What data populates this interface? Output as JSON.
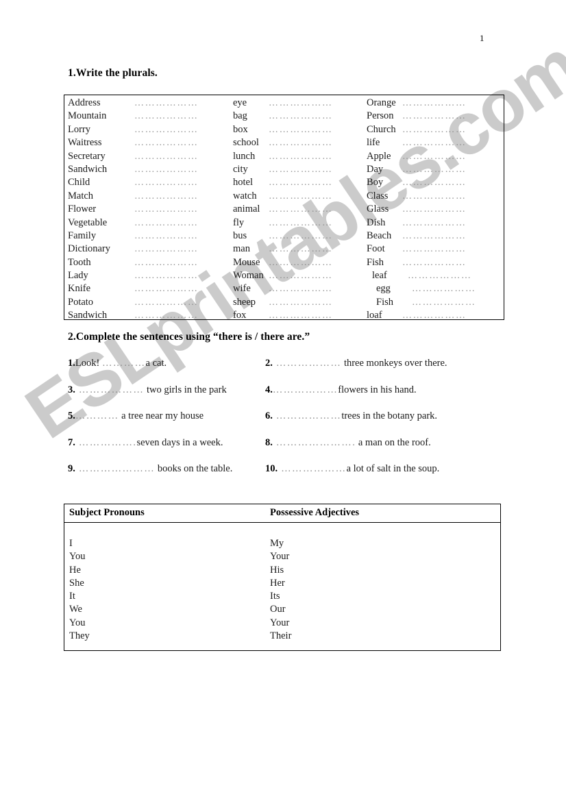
{
  "page": {
    "number": "1",
    "watermark": "ESLprintables.com",
    "watermark_color": "#c9c9c9"
  },
  "sections": {
    "plurals": {
      "heading": "1.Write the plurals.",
      "dots": "………………",
      "columns": [
        {
          "id": "column-1",
          "words": [
            "Address",
            "Mountain",
            "Lorry",
            "Waitress",
            "Secretary",
            "Sandwich",
            "Child",
            "Match",
            "Flower",
            "Vegetable",
            "Family",
            "Dictionary",
            "Tooth",
            "Lady",
            "Knife",
            "Potato",
            "Sandwich"
          ]
        },
        {
          "id": "column-2",
          "words": [
            "eye",
            "bag",
            "box",
            "school",
            "lunch",
            "city",
            "hotel",
            "watch",
            "animal",
            "fly",
            "bus",
            "man",
            "Mouse",
            "Woman",
            "wife",
            "sheep",
            "fox"
          ]
        },
        {
          "id": "column-3",
          "words": [
            "Orange",
            "Person",
            "Church",
            "life",
            "Apple",
            "Day",
            "Boy",
            "Class",
            "Glass",
            "Dish",
            "Beach",
            "Foot",
            "Fish",
            "leaf",
            "egg",
            "Fish",
            "loaf"
          ]
        }
      ]
    },
    "there_is_there_are": {
      "heading": "2.Complete the sentences using  “there is / there are.”",
      "items": [
        {
          "number": "1.",
          "lead": "Look! ",
          "dots": "…………",
          "text": "a cat."
        },
        {
          "number": "2.",
          "lead": "",
          "dots": " ………………",
          "text": " three monkeys over there."
        },
        {
          "number": "3.",
          "lead": "",
          "dots": " ………………",
          "text": " two girls in the park"
        },
        {
          "number": "4.",
          "lead": "",
          "dots": "………………",
          "text": "flowers in his hand."
        },
        {
          "number": "5.",
          "lead": "",
          "dots": "…………",
          "text": " a tree near my house"
        },
        {
          "number": "6.",
          "lead": "",
          "dots": " ………………",
          "text": "trees in the botany park."
        },
        {
          "number": "7.",
          "lead": "",
          "dots": " …………….",
          "text": "seven days in a week."
        },
        {
          "number": "8.",
          "lead": "",
          "dots": " ………………….",
          "text": " a man on the roof."
        },
        {
          "number": "9.",
          "lead": "",
          "dots": " …………………",
          "text": " books on the table."
        },
        {
          "number": "10.",
          "lead": "",
          "dots": " ………………",
          "text": "a lot of salt in the soup."
        }
      ]
    },
    "pronouns": {
      "headers": {
        "subject": "Subject Pronouns",
        "possessive": "Possessive Adjectives"
      },
      "rows": [
        {
          "subject": "I",
          "possessive": "My"
        },
        {
          "subject": "You",
          "possessive": "Your"
        },
        {
          "subject": "He",
          "possessive": "His"
        },
        {
          "subject": "She",
          "possessive": "Her"
        },
        {
          "subject": "It",
          "possessive": "Its"
        },
        {
          "subject": "We",
          "possessive": "Our"
        },
        {
          "subject": "You",
          "possessive": "Your"
        },
        {
          "subject": "They",
          "possessive": "Their"
        }
      ]
    }
  }
}
